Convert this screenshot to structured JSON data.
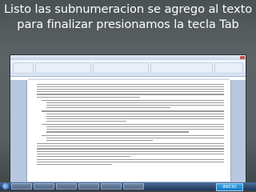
{
  "slide": {
    "title": "Listo las subnumeracion se agrego al texto para finalizar presionamos la tecla Tab",
    "background_color": "#585e61",
    "title_color": "#ffffff"
  },
  "screenshot": {
    "app": "word-processor",
    "window_title": "",
    "icons": [
      "minimize-icon",
      "maximize-icon",
      "close-icon"
    ]
  },
  "navigation": {
    "inicio_label": "INICIO",
    "inicio_color": "#1e8fd6"
  }
}
